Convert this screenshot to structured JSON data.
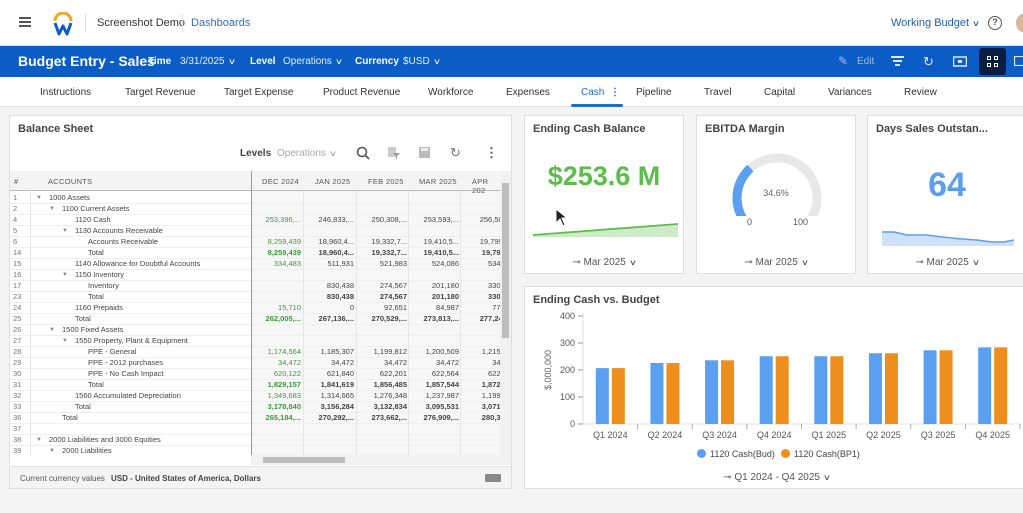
{
  "header": {
    "app_name": "Screenshot Demo",
    "breadcrumb": "Dashboards",
    "budget_selector": "Working Budget",
    "help": "?"
  },
  "toolbar": {
    "title": "Budget Entry - Sales",
    "time_label": "Time",
    "time_value": "3/31/2025",
    "level_label": "Level",
    "level_value": "Operations",
    "currency_label": "Currency",
    "currency_value": "$USD",
    "edit_label": "Edit",
    "icons": [
      "edit-icon",
      "filter-icon",
      "refresh-icon",
      "camera-icon",
      "grid-view-icon",
      "export-icon"
    ]
  },
  "tabs": [
    {
      "label": "Instructions"
    },
    {
      "label": "Target Revenue"
    },
    {
      "label": "Target Expense"
    },
    {
      "label": "Product Revenue"
    },
    {
      "label": "Workforce"
    },
    {
      "label": "Expenses"
    },
    {
      "label": "Cash",
      "active": true
    },
    {
      "label": "Pipeline"
    },
    {
      "label": "Travel"
    },
    {
      "label": "Capital"
    },
    {
      "label": "Variances"
    },
    {
      "label": "Review"
    }
  ],
  "balance_sheet": {
    "title": "Balance Sheet",
    "levels_label": "Levels",
    "levels_value": "Operations",
    "columns": [
      "#",
      "ACCOUNTS",
      "DEC 2024",
      "JAN 2025",
      "FEB 2025",
      "MAR 2025",
      "APR 202"
    ],
    "rows": [
      {
        "n": "1",
        "indent": 0,
        "arrow": true,
        "name": "1000 Assets",
        "vals": [
          "",
          "",
          "",
          "",
          ""
        ]
      },
      {
        "n": "2",
        "indent": 1,
        "arrow": true,
        "name": "1100 Current Assets",
        "vals": [
          "",
          "",
          "",
          "",
          ""
        ]
      },
      {
        "n": "4",
        "indent": 2,
        "name": "1120 Cash",
        "vals": [
          "253,396,...",
          "246,833,...",
          "250,308,...",
          "253,593,...",
          "256,505,."
        ]
      },
      {
        "n": "5",
        "indent": 2,
        "arrow": true,
        "name": "1130 Accounts Receivable",
        "vals": [
          "",
          "",
          "",
          "",
          ""
        ]
      },
      {
        "n": "6",
        "indent": 3,
        "name": "Accounts Receivable",
        "vals": [
          "8,259,439",
          "18,960,4...",
          "19,332,7...",
          "19,410,5...",
          "19,799,6."
        ]
      },
      {
        "n": "14",
        "indent": 3,
        "name": "Total",
        "bold": true,
        "vals": [
          "8,259,439",
          "18,960,4...",
          "19,332,7...",
          "19,410,5...",
          "19,799,6"
        ]
      },
      {
        "n": "15",
        "indent": 2,
        "name": "1140 Allowance for Doubtful Accounts",
        "vals": [
          "334,483",
          "511,931",
          "521,983",
          "524,086",
          "534,59"
        ]
      },
      {
        "n": "16",
        "indent": 2,
        "arrow": true,
        "name": "1150 Inventory",
        "vals": [
          "",
          "",
          "",
          "",
          ""
        ]
      },
      {
        "n": "17",
        "indent": 3,
        "name": "Inventory",
        "vals": [
          "",
          "830,438",
          "274,567",
          "201,180",
          "330,31"
        ]
      },
      {
        "n": "23",
        "indent": 3,
        "name": "Total",
        "bold": true,
        "vals": [
          "",
          "830,438",
          "274,567",
          "201,180",
          "330,31"
        ]
      },
      {
        "n": "24",
        "indent": 2,
        "name": "1160 Prepaids",
        "vals": [
          "15,710",
          "0",
          "92,651",
          "84,987",
          "77,31"
        ]
      },
      {
        "n": "25",
        "indent": 2,
        "name": "Total",
        "bold": true,
        "vals": [
          "262,005,...",
          "267,136,...",
          "270,529,...",
          "273,813,...",
          "277,247,."
        ]
      },
      {
        "n": "26",
        "indent": 1,
        "arrow": true,
        "name": "1500 Fixed Assets",
        "vals": [
          "",
          "",
          "",
          "",
          ""
        ]
      },
      {
        "n": "27",
        "indent": 2,
        "arrow": true,
        "name": "1550 Property, Plant & Equipment",
        "vals": [
          "",
          "",
          "",
          "",
          ""
        ]
      },
      {
        "n": "28",
        "indent": 3,
        "name": "PPE - General",
        "vals": [
          "1,174,564",
          "1,185,307",
          "1,199,812",
          "1,200,509",
          "1,215,05"
        ]
      },
      {
        "n": "29",
        "indent": 3,
        "name": "PPE - 2012 purchases",
        "vals": [
          "34,472",
          "34,472",
          "34,472",
          "34,472",
          "34,47"
        ]
      },
      {
        "n": "30",
        "indent": 3,
        "name": "PPE - No Cash Impact",
        "vals": [
          "620,122",
          "621,840",
          "622,201",
          "622,564",
          "622,92"
        ]
      },
      {
        "n": "31",
        "indent": 3,
        "name": "Total",
        "bold": true,
        "vals": [
          "1,829,157",
          "1,841,619",
          "1,856,485",
          "1,857,544",
          "1,872,45"
        ]
      },
      {
        "n": "32",
        "indent": 2,
        "name": "1560 Accumulated Depreciation",
        "vals": [
          "1,349,683",
          "1,314,665",
          "1,276,348",
          "1,237,987",
          "1,199,19"
        ]
      },
      {
        "n": "33",
        "indent": 2,
        "name": "Total",
        "bold": true,
        "vals": [
          "3,178,840",
          "3,156,284",
          "3,132,834",
          "3,095,531",
          "3,071,64"
        ]
      },
      {
        "n": "36",
        "indent": 1,
        "name": "Total",
        "bold": true,
        "vals": [
          "265,184,...",
          "270,292,...",
          "273,662,...",
          "276,909,...",
          "280,319,"
        ]
      },
      {
        "n": "37",
        "indent": 0,
        "name": "",
        "vals": [
          "",
          "",
          "",
          "",
          ""
        ]
      },
      {
        "n": "38",
        "indent": 0,
        "arrow": true,
        "name": "2000 Liabilities and 3000 Equities",
        "vals": [
          "",
          "",
          "",
          "",
          ""
        ]
      },
      {
        "n": "39",
        "indent": 1,
        "arrow": true,
        "name": "2000 Liabilities",
        "vals": [
          "",
          "",
          "",
          "",
          ""
        ]
      }
    ],
    "footer_label": "Current currency values",
    "footer_value": "USD - United States of America, Dollars"
  },
  "kpis": {
    "ending_cash": {
      "title": "Ending Cash Balance",
      "value": "$253.6 M",
      "period": "Mar 2025",
      "color": "#5cbd4a"
    },
    "ebitda": {
      "title": "EBITDA Margin",
      "value": "34.6%",
      "gauge_fraction": 0.346,
      "min": "0",
      "max": "100",
      "period": "Mar 2025",
      "color": "#5b9ff0"
    },
    "dso": {
      "title": "Days Sales Outstan...",
      "value": "64",
      "period": "Mar 2025",
      "color": "#5b9ff0"
    }
  },
  "chart_data": {
    "type": "bar",
    "title": "Ending Cash vs. Budget",
    "ylabel": "$,000,000",
    "xlabel": "",
    "ylim": [
      0,
      400
    ],
    "yticks": [
      0,
      100,
      200,
      300,
      400
    ],
    "categories": [
      "Q1 2024",
      "Q2 2024",
      "Q3 2024",
      "Q4 2024",
      "Q1 2025",
      "Q2 2025",
      "Q3 2025",
      "Q4 2025"
    ],
    "series": [
      {
        "name": "1120 Cash(Bud)",
        "color": "#5b9ff0",
        "values": [
          207,
          226,
          236,
          251,
          251,
          262,
          273,
          284
        ]
      },
      {
        "name": "1120 Cash(BP1)",
        "color": "#ee8e1c",
        "values": [
          207,
          226,
          236,
          251,
          251,
          262,
          273,
          284
        ]
      }
    ],
    "legend": "bottom",
    "period": "Q1 2024 - Q4 2025"
  }
}
